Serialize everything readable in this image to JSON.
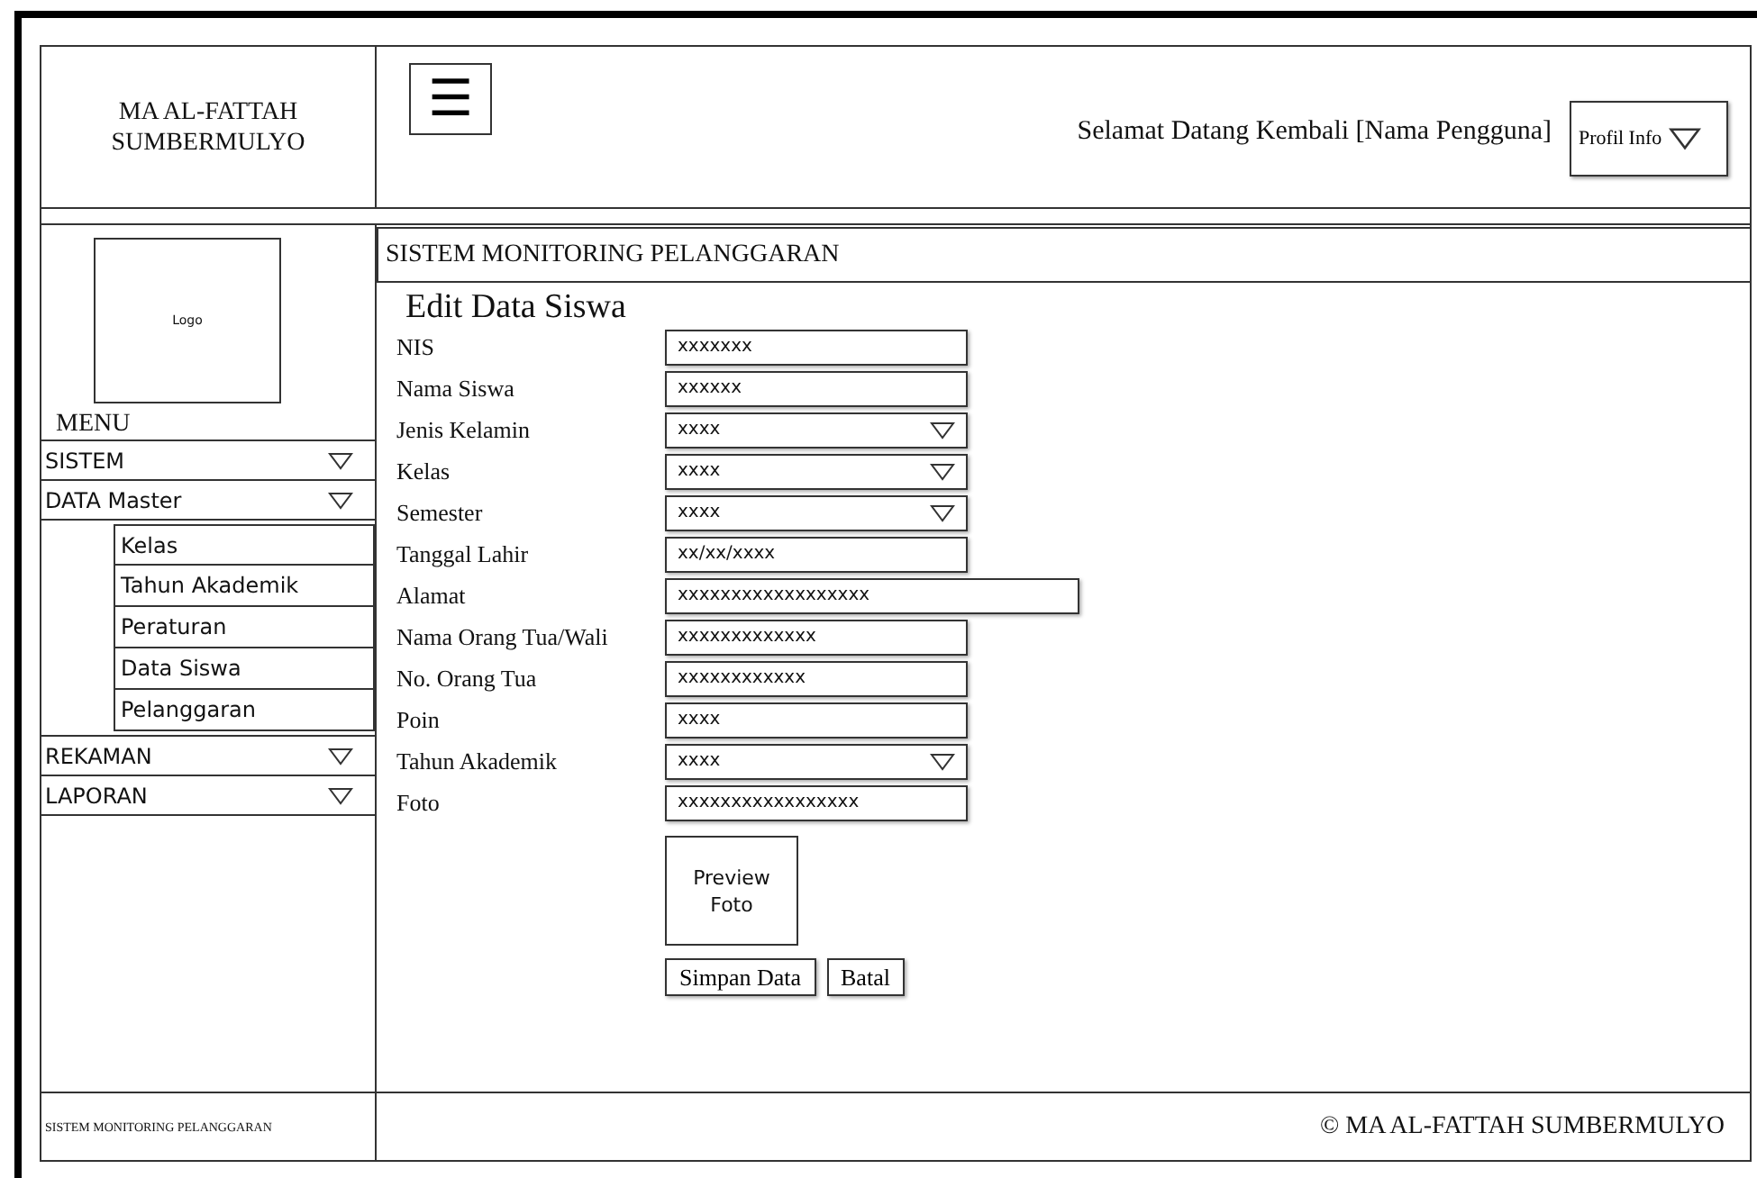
{
  "brand": {
    "name_lines": [
      "MA AL-FATTAH",
      "SUMBERMULYO"
    ]
  },
  "header": {
    "menu_icon": "☰",
    "welcome": "Selamat Datang Kembali [Nama Pengguna]",
    "profile_button": "Profil Info"
  },
  "sidebar": {
    "logo": "Logo",
    "menu_title": "MENU",
    "items": [
      {
        "label": "SISTEM"
      },
      {
        "label": "DATA Master",
        "children": [
          {
            "label": "Kelas"
          },
          {
            "label": "Tahun Akademik"
          },
          {
            "label": "Peraturan"
          },
          {
            "label": "Data Siswa"
          },
          {
            "label": "Pelanggaran"
          }
        ]
      },
      {
        "label": "REKAMAN"
      },
      {
        "label": "LAPORAN"
      }
    ]
  },
  "page_title": "SISTEM MONITORING PELANGGARAN",
  "form": {
    "title": "Edit Data Siswa",
    "fields": [
      {
        "label": "NIS",
        "kind": "text",
        "value": "xxxxxxx"
      },
      {
        "label": "Nama Siswa",
        "kind": "text",
        "value": "xxxxxx"
      },
      {
        "label": "Jenis Kelamin",
        "kind": "select",
        "value": "xxxx"
      },
      {
        "label": "Kelas",
        "kind": "select",
        "value": "xxxx"
      },
      {
        "label": "Semester",
        "kind": "select",
        "value": "xxxx"
      },
      {
        "label": "Tanggal Lahir",
        "kind": "text",
        "value": "xx/xx/xxxx"
      },
      {
        "label": "Alamat",
        "kind": "wide",
        "value": "xxxxxxxxxxxxxxxxxx"
      },
      {
        "label": "Nama Orang Tua/Wali",
        "kind": "text",
        "value": "xxxxxxxxxxxxx"
      },
      {
        "label": "No. Orang Tua",
        "kind": "text",
        "value": "xxxxxxxxxxxx"
      },
      {
        "label": "Poin",
        "kind": "text",
        "value": "xxxx"
      },
      {
        "label": "Tahun Akademik",
        "kind": "select",
        "value": "xxxx"
      },
      {
        "label": "Foto",
        "kind": "text",
        "value": "xxxxxxxxxxxxxxxxx"
      }
    ],
    "preview": "Preview Foto",
    "buttons": [
      "Simpan Data",
      "Batal"
    ]
  },
  "footer": {
    "left": "SISTEM MONITORING PELANGGARAN",
    "right": "© MA AL-FATTAH SUMBERMULYO"
  }
}
